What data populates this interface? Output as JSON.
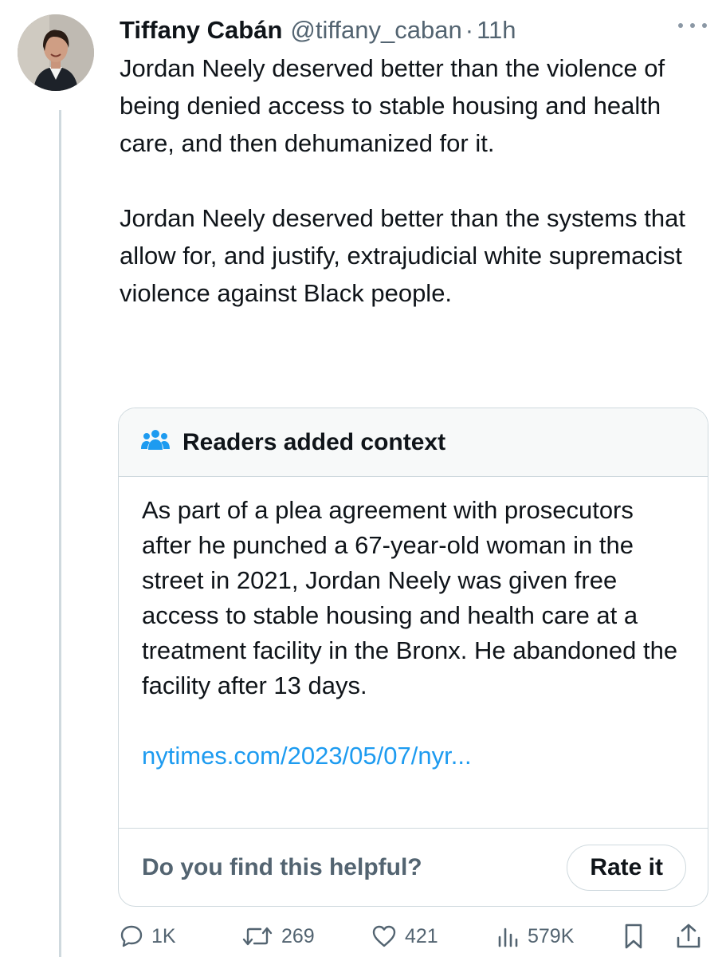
{
  "tweet": {
    "author_name": "Tiffany Cabán",
    "author_handle": "@tiffany_caban",
    "separator": "·",
    "time": "11h",
    "paragraphs": [
      "Jordan Neely deserved better than the violence of being denied access to stable housing and health care, and then dehumanized for it.",
      "Jordan Neely deserved better than the systems that allow for, and justify, extrajudicial white supremacist violence against Black people."
    ]
  },
  "community_note": {
    "header": "Readers added context",
    "icon": "people-icon",
    "body": "As part of a plea agreement with prosecutors after he punched a  67-year-old woman in the street in 2021, Jordan Neely was given free access to stable housing and health care at a treatment facility in the Bronx. He abandoned the facility after 13 days.",
    "link": "nytimes.com/2023/05/07/nyr...",
    "question": "Do you find this helpful?",
    "rate_label": "Rate it"
  },
  "actions": {
    "replies": "1K",
    "retweets": "269",
    "likes": "421",
    "views": "579K"
  },
  "colors": {
    "text": "#0f1419",
    "secondary": "#536471",
    "link": "#1d9bf0",
    "border": "#cfd9de",
    "note_header_bg": "#f7f9f9"
  }
}
